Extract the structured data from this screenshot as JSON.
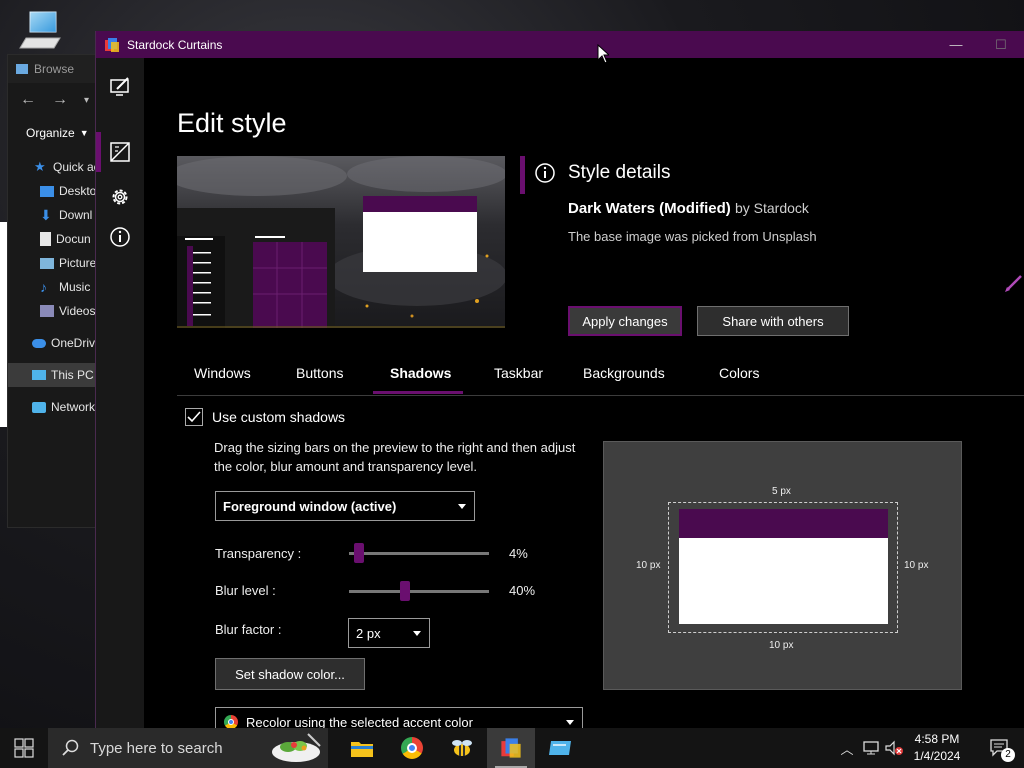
{
  "desktop": {
    "icon": "computer-icon"
  },
  "explorer": {
    "title": "Browse",
    "organize": "Organize",
    "items": [
      {
        "label": "Quick ac",
        "icon": "star-icon"
      },
      {
        "label": "Deskto",
        "icon": "desktop-folder-icon"
      },
      {
        "label": "Downl",
        "icon": "download-icon"
      },
      {
        "label": "Docun",
        "icon": "document-icon"
      },
      {
        "label": "Picture",
        "icon": "picture-icon"
      },
      {
        "label": "Music",
        "icon": "music-icon"
      },
      {
        "label": "Videos",
        "icon": "video-icon"
      },
      {
        "label": "OneDriv",
        "icon": "cloud-icon"
      },
      {
        "label": "This PC",
        "icon": "pc-icon"
      },
      {
        "label": "Network",
        "icon": "network-icon"
      }
    ]
  },
  "window": {
    "title": "Stardock Curtains",
    "minimize": "—",
    "maximize": "☐"
  },
  "page": {
    "title": "Edit style"
  },
  "details": {
    "heading": "Style details",
    "name": "Dark Waters (Modified)",
    "by": "by Stardock",
    "description": "The base image was picked from Unsplash",
    "apply_label": "Apply changes",
    "share_label": "Share with others"
  },
  "tabs": [
    {
      "label": "Windows"
    },
    {
      "label": "Buttons"
    },
    {
      "label": "Shadows"
    },
    {
      "label": "Taskbar"
    },
    {
      "label": "Backgrounds"
    },
    {
      "label": "Colors"
    }
  ],
  "active_tab": "Shadows",
  "shadows": {
    "use_custom_label": "Use custom shadows",
    "use_custom_checked": true,
    "instructions": "Drag the sizing bars on the preview to the right and then adjust the color, blur amount and transparency level.",
    "window_select": "Foreground window (active)",
    "transparency_label": "Transparency :",
    "transparency_value": "4%",
    "transparency_level": 0.07,
    "blur_label": "Blur level :",
    "blur_value": "40%",
    "blur_level": 0.4,
    "blur_factor_label": "Blur factor :",
    "blur_factor_value": "2 px",
    "set_color_label": "Set shadow color...",
    "recolor_label": "Recolor using the selected accent color",
    "preview": {
      "top": "5 px",
      "left": "10 px",
      "right": "10 px",
      "bottom": "10 px"
    }
  },
  "taskbar": {
    "search_placeholder": "Type here to search",
    "time": "4:58 PM",
    "date": "1/4/2024",
    "notifications": "2"
  },
  "colors": {
    "accent": "#6a0f6f",
    "titlebar": "#4a0a4f"
  }
}
